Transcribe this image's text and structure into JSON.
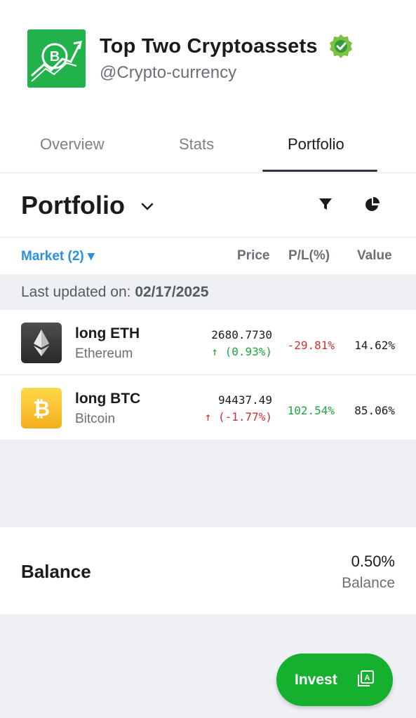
{
  "header": {
    "title": "Top Two Cryptoassets",
    "handle": "@Crypto-currency",
    "logo_letter": "B",
    "brand_color": "#22b24c",
    "verified_color": "#7cc142"
  },
  "tabs": [
    {
      "label": "Overview",
      "active": false
    },
    {
      "label": "Stats",
      "active": false
    },
    {
      "label": "Portfolio",
      "active": true
    }
  ],
  "portfolio": {
    "title": "Portfolio",
    "icons": [
      "chevron-down-icon",
      "filter-icon",
      "pie-chart-icon"
    ]
  },
  "columns": {
    "market": "Market (2) ▾",
    "price": "Price",
    "pl": "P/L(%)",
    "value": "Value"
  },
  "updated": {
    "label": "Last updated on:",
    "date": "02/17/2025"
  },
  "rows": [
    {
      "name": "long ETH",
      "subtitle": "Ethereum",
      "price": "2680.7730",
      "change": "↑ (0.93%)",
      "change_color": "#1fa843",
      "pl": "-29.81%",
      "pl_color": "#d32f2f",
      "value": "14.62%"
    },
    {
      "name": "long BTC",
      "subtitle": "Bitcoin",
      "price": "94437.49",
      "change": "↑ (-1.77%)",
      "change_color": "#d32f2f",
      "pl": "102.54%",
      "pl_color": "#1fa843",
      "value": "85.06%"
    }
  ],
  "balance": {
    "label": "Balance",
    "value": "0.50%",
    "sublabel": "Balance"
  },
  "invest": {
    "label": "Invest",
    "color": "#16b02f"
  }
}
